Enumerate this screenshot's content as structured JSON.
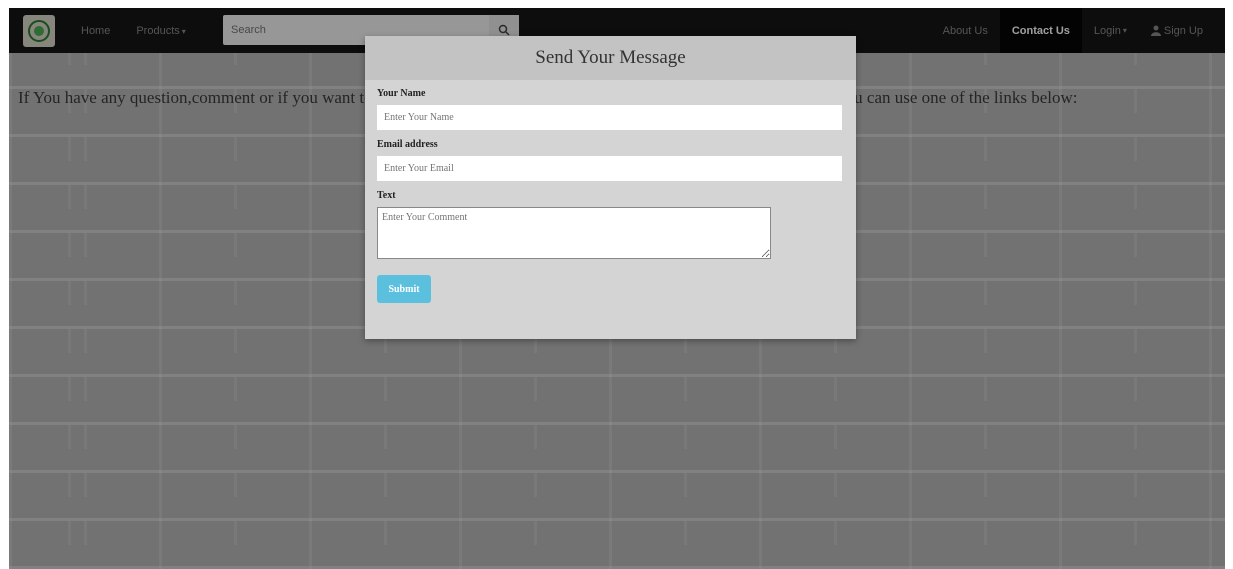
{
  "navbar": {
    "home": "Home",
    "products": "Products",
    "search_placeholder": "Search",
    "about": "About Us",
    "contact": "Contact Us",
    "login": "Login",
    "signup": "Sign Up"
  },
  "intro": {
    "text": "If You have any question,comment or if you want to share any suggestion with us, simply fill out the form, alternatively you can use one of the links below:"
  },
  "modal": {
    "title": "Send Your Message",
    "name_label": "Your Name",
    "name_placeholder": "Enter Your Name",
    "email_label": "Email address",
    "email_placeholder": "Enter Your Email",
    "text_label": "Text",
    "text_placeholder": "Enter Your Comment",
    "submit": "Submit"
  },
  "colors": {
    "navbar_bg": "#161616",
    "submit_bg": "#5bc0de",
    "modal_bg": "#d4d4d4"
  },
  "icons": {
    "logo": "green-circle-logo-icon",
    "search": "search-icon",
    "signup": "user-icon"
  }
}
